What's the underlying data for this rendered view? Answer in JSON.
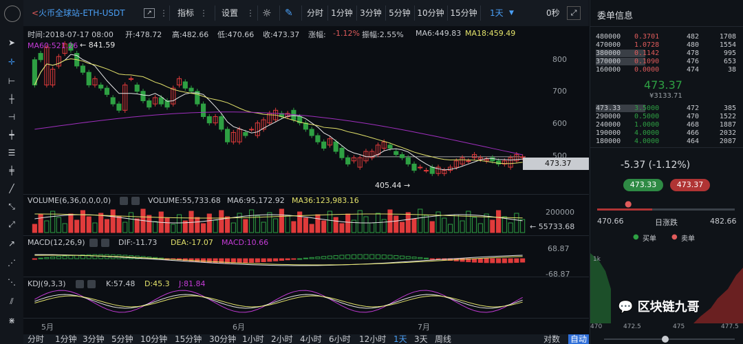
{
  "toolbar": {
    "title": "火币全球站-ETH-USDT",
    "indicators_label": "指标",
    "settings_label": "设置",
    "periods": [
      "分时",
      "1分钟",
      "3分钟",
      "5分钟",
      "10分钟",
      "15分钟"
    ],
    "selected_period": "1天",
    "countdown": "0秒"
  },
  "ohlc": {
    "time": "时间:2018-07-17 08:00",
    "open": "开:478.72",
    "high": "高:482.66",
    "low": "低:470.66",
    "close": "收:473.37",
    "change_label": "涨幅:",
    "change_value": "-1.12%",
    "amplitude": "振幅:2.55%",
    "ma6": "MA6:449.83",
    "ma18": "MA18:459.49",
    "ma60": "MA60:521.26"
  },
  "price_axis": [
    "800",
    "700",
    "600",
    "500"
  ],
  "current_price": "473.37",
  "annotations": {
    "high": "841.59",
    "low": "405.44"
  },
  "volume": {
    "title": "VOLUME(6,36,0,0,0,0)",
    "volume": "VOLUME:55,733.68",
    "ma6": "MA6:95,172.92",
    "ma36": "MA36:123,983.16",
    "axis_top": "200000",
    "last": "55733.68"
  },
  "macd": {
    "title": "MACD(12,26,9)",
    "dif": "DIF:-11.73",
    "dea": "DEA:-17.07",
    "macd": "MACD:10.66",
    "axis_top": "68.87",
    "axis_bottom": "-68.87"
  },
  "kdj": {
    "title": "KDJ(9,3,3)",
    "k": "K:57.48",
    "d": "D:45.3",
    "j": "J:81.84"
  },
  "time_axis": [
    "5月",
    "6月",
    "7月"
  ],
  "bottom_periods": [
    "分时",
    "1分钟",
    "3分钟",
    "5分钟",
    "10分钟",
    "15分钟",
    "30分钟",
    "1小时",
    "2小时",
    "4小时",
    "6小时",
    "12小时",
    "1天",
    "3天",
    "周线"
  ],
  "bottom_right": [
    "对数",
    "自动"
  ],
  "orderbook": {
    "title": "委单信息",
    "asks": [
      [
        "480000",
        "0.3701",
        "482",
        "1708"
      ],
      [
        "470000",
        "1.0728",
        "480",
        "1554"
      ],
      [
        "380000",
        "0.1142",
        "478",
        "995"
      ],
      [
        "370000",
        "0.1090",
        "476",
        "653"
      ],
      [
        "160000",
        "0.0000",
        "474",
        "38"
      ]
    ],
    "mid_price": "473.37",
    "mid_cny": "¥3133.71",
    "bids": [
      [
        "473.33",
        "3.5000",
        "472",
        "385"
      ],
      [
        "290000",
        "0.5000",
        "470",
        "1522"
      ],
      [
        "240000",
        "1.0000",
        "468",
        "1887"
      ],
      [
        "190000",
        "4.0000",
        "466",
        "2032"
      ],
      [
        "180000",
        "4.0000",
        "464",
        "2087"
      ]
    ],
    "change": "-5.37 (-1.12%)",
    "buy_price": "473.33",
    "sell_price": "473.37",
    "range_low": "470.66",
    "range_label": "日涨跌",
    "range_high": "482.66",
    "legend_buy": "买单",
    "legend_sell": "卖单",
    "depth_axis": [
      "1k"
    ],
    "depth_x": [
      "470",
      "472.5",
      "475",
      "477.5"
    ],
    "watermark": "区块链九哥"
  },
  "colors": {
    "up": "#e03b3b",
    "down": "#2ea043",
    "ma6": "#e8e8e8",
    "ma18": "#e4e36b",
    "ma60": "#a02fbf",
    "dif": "#e8e8e8",
    "dea": "#e4e36b",
    "kdj_j": "#c43bd6"
  },
  "chart_data": {
    "type": "candlestick",
    "open": [
      780,
      800,
      700,
      700,
      760,
      800,
      830,
      800,
      760,
      740,
      700,
      700,
      690,
      660,
      640,
      620,
      720,
      700,
      680,
      650,
      640,
      660,
      650,
      640,
      700,
      710,
      690,
      680,
      640,
      600,
      580,
      600,
      560,
      520,
      520,
      550,
      560,
      540,
      560,
      580,
      590,
      610,
      600,
      620,
      600,
      580,
      560,
      540,
      520,
      510,
      520,
      500,
      470,
      460,
      440,
      460,
      470,
      480,
      500,
      510,
      490,
      480,
      470,
      450,
      440,
      430,
      440,
      420,
      420,
      430,
      440,
      450,
      460,
      470,
      465,
      460,
      470,
      460,
      450,
      440,
      460,
      470
    ],
    "close": [
      700,
      780,
      820,
      750,
      790,
      830,
      810,
      760,
      740,
      700,
      720,
      690,
      670,
      640,
      620,
      700,
      720,
      680,
      650,
      630,
      660,
      640,
      630,
      690,
      720,
      690,
      680,
      640,
      600,
      580,
      600,
      560,
      520,
      550,
      560,
      540,
      560,
      580,
      590,
      610,
      620,
      600,
      610,
      590,
      580,
      560,
      540,
      520,
      500,
      530,
      490,
      470,
      450,
      470,
      470,
      490,
      490,
      510,
      520,
      500,
      480,
      470,
      450,
      430,
      440,
      430,
      420,
      440,
      430,
      440,
      460,
      470,
      460,
      480,
      470,
      465,
      460,
      450,
      460,
      470,
      480,
      473
    ]
  }
}
